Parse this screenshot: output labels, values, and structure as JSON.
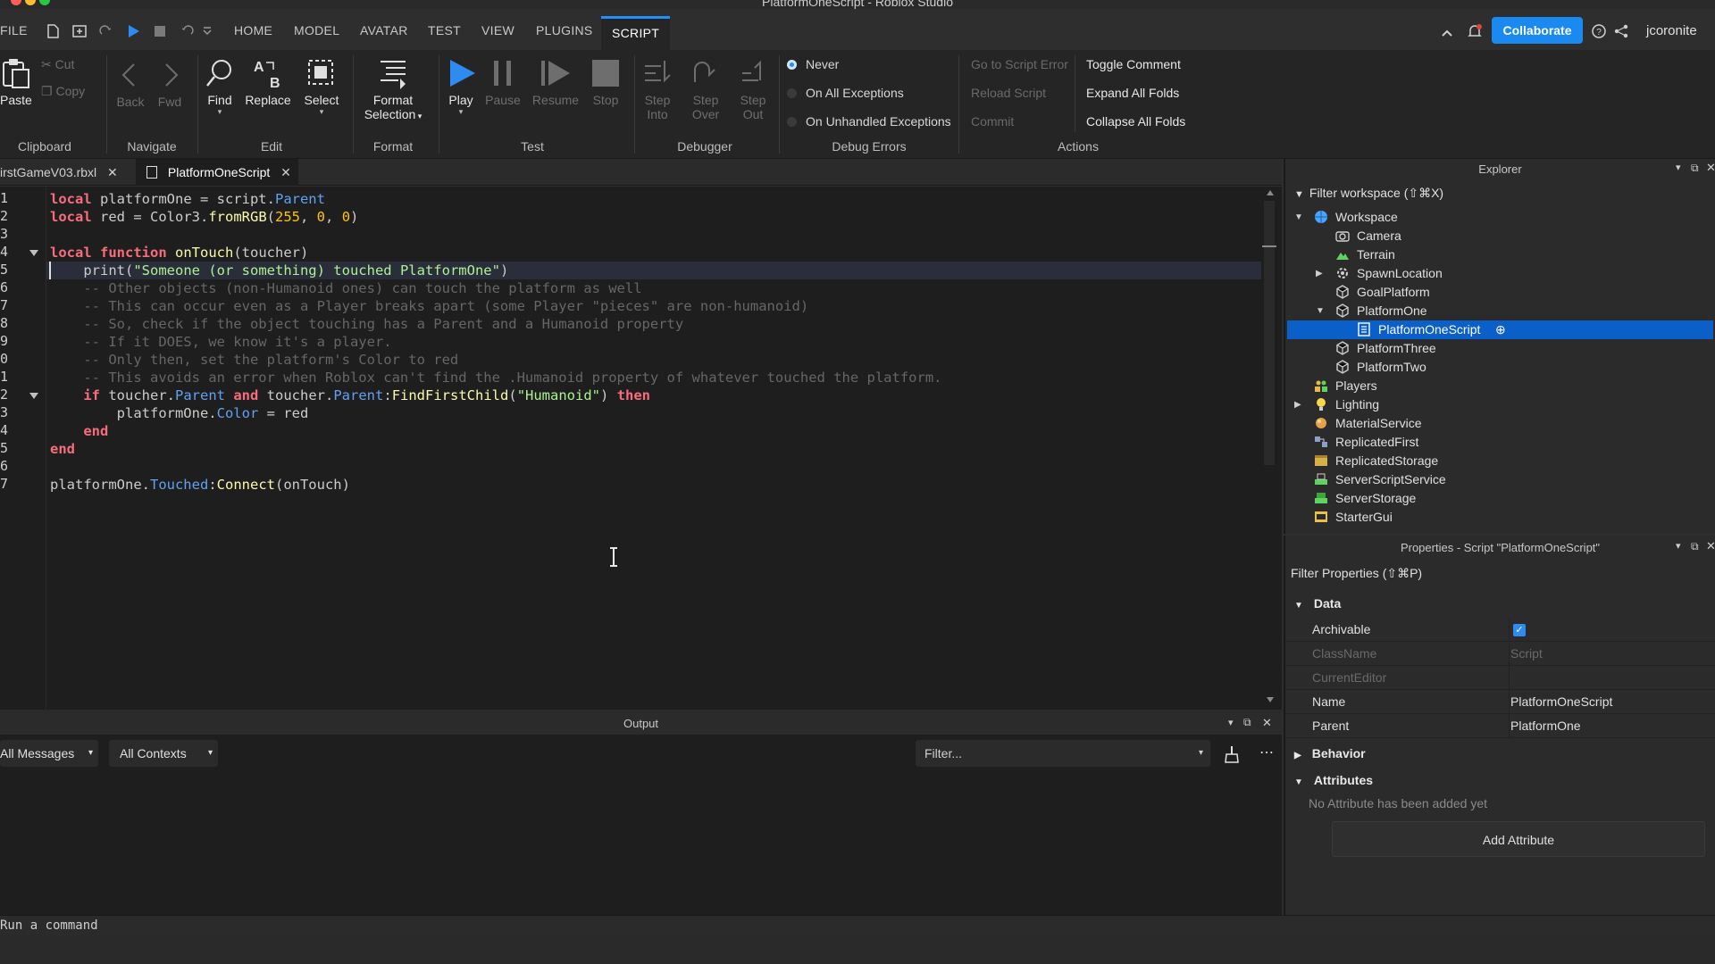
{
  "window": {
    "title": "PlatformOneScript - Roblox Studio"
  },
  "menu": {
    "file": "FILE",
    "tabs": [
      "HOME",
      "MODEL",
      "AVATAR",
      "TEST",
      "VIEW",
      "PLUGINS",
      "SCRIPT"
    ],
    "active_tab": "SCRIPT",
    "collaborate": "Collaborate",
    "username": "jcoronite"
  },
  "ribbon": {
    "clipboard": {
      "label": "Clipboard",
      "paste": "Paste",
      "cut": "Cut",
      "copy": "Copy"
    },
    "navigate": {
      "label": "Navigate",
      "back": "Back",
      "fwd": "Fwd"
    },
    "edit": {
      "label": "Edit",
      "find": "Find",
      "replace": "Replace",
      "select": "Select"
    },
    "format": {
      "label": "Format",
      "format_selection_1": "Format",
      "format_selection_2": "Selection"
    },
    "test": {
      "label": "Test",
      "play": "Play",
      "pause": "Pause",
      "resume": "Resume",
      "stop": "Stop"
    },
    "debugger": {
      "label": "Debugger",
      "step_into_1": "Step",
      "step_into_2": "Into",
      "step_over_1": "Step",
      "step_over_2": "Over",
      "step_out_1": "Step",
      "step_out_2": "Out"
    },
    "debug_errors": {
      "label": "Debug Errors",
      "options": [
        "Never",
        "On All Exceptions",
        "On Unhandled Exceptions"
      ],
      "selected": "Never"
    },
    "actions": {
      "label": "Actions",
      "go_to_script_error": "Go to Script Error",
      "reload_script": "Reload Script",
      "commit": "Commit",
      "toggle_comment": "Toggle Comment",
      "expand_all_folds": "Expand All Folds",
      "collapse_all_folds": "Collapse All Folds"
    }
  },
  "doc_tabs": [
    {
      "label": "irstGameV03.rbxl"
    },
    {
      "label": "PlatformOneScript"
    }
  ],
  "editor": {
    "line_numbers": [
      "1",
      "2",
      "3",
      "4",
      "5",
      "6",
      "7",
      "8",
      "9",
      "0",
      "1",
      "2",
      "3",
      "4",
      "5",
      "6",
      "7"
    ],
    "l1": {
      "a": "local",
      "b": " platformOne = script.",
      "c": "Parent"
    },
    "l2": {
      "a": "local",
      "b": " red = Color3.",
      "c": "fromRGB",
      "d": "(",
      "e": "255",
      "f": ", ",
      "g": "0",
      "h": ", ",
      "i": "0",
      "j": ")"
    },
    "l4": {
      "a": "local function",
      "b": " ",
      "c": "onTouch",
      "d": "(toucher)"
    },
    "l5": {
      "a": "    ",
      "b": "print",
      "c": "(",
      "d": "\"Someone (or something) touched PlatformOne\"",
      "e": ")"
    },
    "l6": "    -- Other objects (non-Humanoid ones) can touch the platform as well",
    "l7": "    -- This can occur even as a Player breaks apart (some Player \"pieces\" are non-humanoid)",
    "l8": "    -- So, check if the object touching has a Parent and a Humanoid property",
    "l9": "    -- If it DOES, we know it's a player.",
    "l10": "    -- Only then, set the platform's Color to red",
    "l11": "    -- This avoids an error when Roblox can't find the .Humanoid property of whatever touched the platform.",
    "l12": {
      "a": "    ",
      "b": "if",
      "c": " toucher.",
      "d": "Parent",
      "e": " ",
      "f": "and",
      "g": " toucher.",
      "h": "Parent",
      "i": ":",
      "j": "FindFirstChild",
      "k": "(",
      "l": "\"Humanoid\"",
      "m": ") ",
      "n": "then"
    },
    "l13": {
      "a": "        platformOne.",
      "b": "Color",
      "c": " = red"
    },
    "l14": {
      "a": "    ",
      "b": "end"
    },
    "l15": "end",
    "l17": {
      "a": "platformOne.",
      "b": "Touched",
      "c": ":",
      "d": "Connect",
      "e": "(onTouch)"
    }
  },
  "output": {
    "title": "Output",
    "messages_filter": "All Messages",
    "contexts_filter": "All Contexts",
    "filter_placeholder": "Filter..."
  },
  "command_bar": {
    "placeholder": "Run a command"
  },
  "explorer": {
    "title": "Explorer",
    "filter": "Filter workspace (⇧⌘X)",
    "items": [
      {
        "label": "Workspace",
        "icon": "workspace-icon",
        "color": "#4aa3ff"
      },
      {
        "label": "Camera",
        "icon": "camera-icon",
        "color": "#cfcfcf"
      },
      {
        "label": "Terrain",
        "icon": "terrain-icon",
        "color": "#5fd35f"
      },
      {
        "label": "SpawnLocation",
        "icon": "spawn-icon",
        "color": "#cfcfcf"
      },
      {
        "label": "GoalPlatform",
        "icon": "part-icon",
        "color": "#cfcfcf"
      },
      {
        "label": "PlatformOne",
        "icon": "part-icon",
        "color": "#cfcfcf"
      },
      {
        "label": "PlatformOneScript",
        "icon": "script-icon",
        "color": "#ffffff"
      },
      {
        "label": "PlatformThree",
        "icon": "part-icon",
        "color": "#cfcfcf"
      },
      {
        "label": "PlatformTwo",
        "icon": "part-icon",
        "color": "#cfcfcf"
      },
      {
        "label": "Players",
        "icon": "players-icon",
        "color": "#e8b84a"
      },
      {
        "label": "Lighting",
        "icon": "lighting-icon",
        "color": "#f5d94a"
      },
      {
        "label": "MaterialService",
        "icon": "material-icon",
        "color": "#e8a04a"
      },
      {
        "label": "ReplicatedFirst",
        "icon": "replicated-first-icon",
        "color": "#8aa0c8"
      },
      {
        "label": "ReplicatedStorage",
        "icon": "replicated-storage-icon",
        "color": "#d8b04a"
      },
      {
        "label": "ServerScriptService",
        "icon": "server-script-icon",
        "color": "#5fd35f"
      },
      {
        "label": "ServerStorage",
        "icon": "server-storage-icon",
        "color": "#5fd35f"
      },
      {
        "label": "StarterGui",
        "icon": "starter-gui-icon",
        "color": "#e8c04a"
      }
    ]
  },
  "properties": {
    "title": "Properties - Script \"PlatformOneScript\"",
    "filter": "Filter Properties (⇧⌘P)",
    "data_section": "Data",
    "rows": [
      {
        "key": "Archivable",
        "value": ""
      },
      {
        "key": "ClassName",
        "value": "Script"
      },
      {
        "key": "CurrentEditor",
        "value": ""
      },
      {
        "key": "Name",
        "value": "PlatformOneScript"
      },
      {
        "key": "Parent",
        "value": "PlatformOne"
      }
    ],
    "behavior_section": "Behavior",
    "attributes_section": "Attributes",
    "no_attributes": "No Attribute has been added yet",
    "add_attribute": "Add Attribute"
  },
  "colors": {
    "accent": "#1b8af0",
    "selection": "#0a5fc9",
    "keyword": "#f86d7c",
    "string": "#adf195",
    "number": "#ffc600",
    "property": "#61a1f1",
    "comment": "#666666"
  }
}
